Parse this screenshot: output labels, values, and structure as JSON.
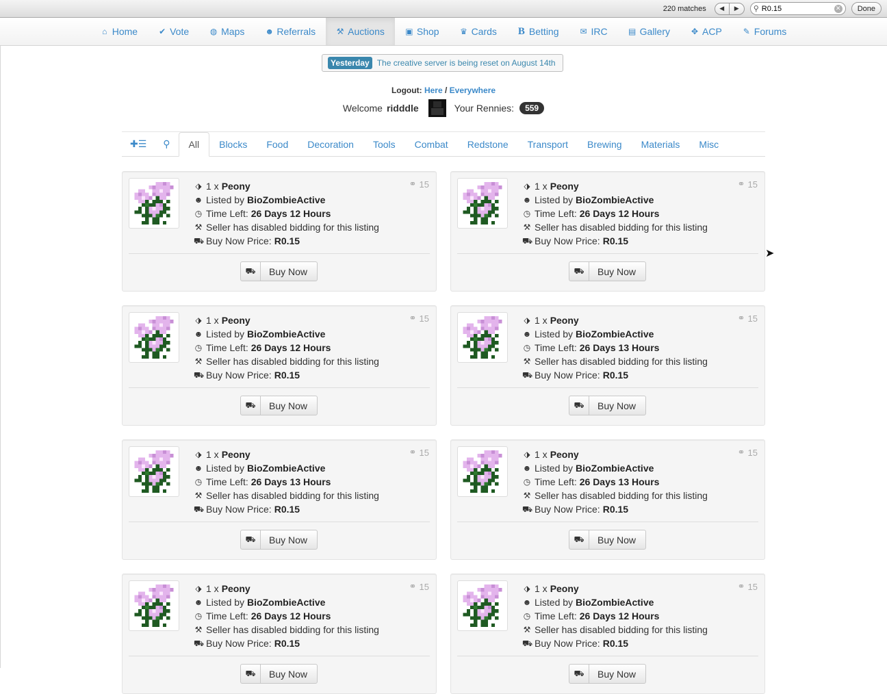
{
  "findbar": {
    "matches": "220 matches",
    "prev_icon": "triangle-left-icon",
    "next_icon": "triangle-right-icon",
    "search_value": "R0.15",
    "done_label": "Done"
  },
  "nav": {
    "items": [
      {
        "label": "Home",
        "icon": "home-icon",
        "glyph": "⌂"
      },
      {
        "label": "Vote",
        "icon": "check-icon",
        "glyph": "✔"
      },
      {
        "label": "Maps",
        "icon": "globe-icon",
        "glyph": "◍"
      },
      {
        "label": "Referrals",
        "icon": "user-icon",
        "glyph": "☻"
      },
      {
        "label": "Auctions",
        "icon": "gavel-icon",
        "glyph": "⚒"
      },
      {
        "label": "Shop",
        "icon": "camera-icon",
        "glyph": "▣"
      },
      {
        "label": "Cards",
        "icon": "trophy-icon",
        "glyph": "♛"
      },
      {
        "label": "Betting",
        "icon": "bold-b-icon",
        "glyph": "B"
      },
      {
        "label": "IRC",
        "icon": "comments-icon",
        "glyph": "✉"
      },
      {
        "label": "Gallery",
        "icon": "picture-icon",
        "glyph": "▤"
      },
      {
        "label": "ACP",
        "icon": "gamepad-icon",
        "glyph": "✥"
      },
      {
        "label": "Forums",
        "icon": "comment-icon",
        "glyph": "✎"
      }
    ],
    "active": "Auctions"
  },
  "announcement": {
    "badge": "Yesterday",
    "message": "The creative server is being reset on August 14th"
  },
  "account": {
    "logout_label": "Logout:",
    "here": "Here",
    "sep": "/",
    "everywhere": "Everywhere",
    "welcome": "Welcome",
    "username": "ridddle",
    "rennies_label": "Your Rennies:",
    "rennies": "559"
  },
  "tabs": {
    "icons": [
      {
        "name": "add-listing-icon",
        "glyph": "✚☰"
      },
      {
        "name": "search-icon",
        "glyph": "⚲"
      }
    ],
    "categories": [
      "All",
      "Blocks",
      "Food",
      "Decoration",
      "Tools",
      "Combat",
      "Redstone",
      "Transport",
      "Brewing",
      "Materials",
      "Misc"
    ],
    "active": "All"
  },
  "listings": [
    {
      "qty": "1 x",
      "item": "Peony",
      "listed_by_label": "Listed by",
      "seller": "BioZombieActive",
      "time_label": "Time Left:",
      "time": "26 Days 12 Hours",
      "bid_note": "Seller has disabled bidding for this listing",
      "price_label": "Buy Now Price:",
      "price": "R0.15",
      "bids": "15",
      "button": "Buy Now"
    },
    {
      "qty": "1 x",
      "item": "Peony",
      "listed_by_label": "Listed by",
      "seller": "BioZombieActive",
      "time_label": "Time Left:",
      "time": "26 Days 12 Hours",
      "bid_note": "Seller has disabled bidding for this listing",
      "price_label": "Buy Now Price:",
      "price": "R0.15",
      "bids": "15",
      "button": "Buy Now"
    },
    {
      "qty": "1 x",
      "item": "Peony",
      "listed_by_label": "Listed by",
      "seller": "BioZombieActive",
      "time_label": "Time Left:",
      "time": "26 Days 12 Hours",
      "bid_note": "Seller has disabled bidding for this listing",
      "price_label": "Buy Now Price:",
      "price": "R0.15",
      "bids": "15",
      "button": "Buy Now"
    },
    {
      "qty": "1 x",
      "item": "Peony",
      "listed_by_label": "Listed by",
      "seller": "BioZombieActive",
      "time_label": "Time Left:",
      "time": "26 Days 13 Hours",
      "bid_note": "Seller has disabled bidding for this listing",
      "price_label": "Buy Now Price:",
      "price": "R0.15",
      "bids": "15",
      "button": "Buy Now"
    },
    {
      "qty": "1 x",
      "item": "Peony",
      "listed_by_label": "Listed by",
      "seller": "BioZombieActive",
      "time_label": "Time Left:",
      "time": "26 Days 13 Hours",
      "bid_note": "Seller has disabled bidding for this listing",
      "price_label": "Buy Now Price:",
      "price": "R0.15",
      "bids": "15",
      "button": "Buy Now"
    },
    {
      "qty": "1 x",
      "item": "Peony",
      "listed_by_label": "Listed by",
      "seller": "BioZombieActive",
      "time_label": "Time Left:",
      "time": "26 Days 13 Hours",
      "bid_note": "Seller has disabled bidding for this listing",
      "price_label": "Buy Now Price:",
      "price": "R0.15",
      "bids": "15",
      "button": "Buy Now"
    },
    {
      "qty": "1 x",
      "item": "Peony",
      "listed_by_label": "Listed by",
      "seller": "BioZombieActive",
      "time_label": "Time Left:",
      "time": "26 Days 12 Hours",
      "bid_note": "Seller has disabled bidding for this listing",
      "price_label": "Buy Now Price:",
      "price": "R0.15",
      "bids": "15",
      "button": "Buy Now"
    },
    {
      "qty": "1 x",
      "item": "Peony",
      "listed_by_label": "Listed by",
      "seller": "BioZombieActive",
      "time_label": "Time Left:",
      "time": "26 Days 12 Hours",
      "bid_note": "Seller has disabled bidding for this listing",
      "price_label": "Buy Now Price:",
      "price": "R0.15",
      "bids": "15",
      "button": "Buy Now"
    }
  ],
  "colors": {
    "link": "#3b89c9",
    "badge": "#3a87ad",
    "card_bg": "#f5f5f5"
  }
}
